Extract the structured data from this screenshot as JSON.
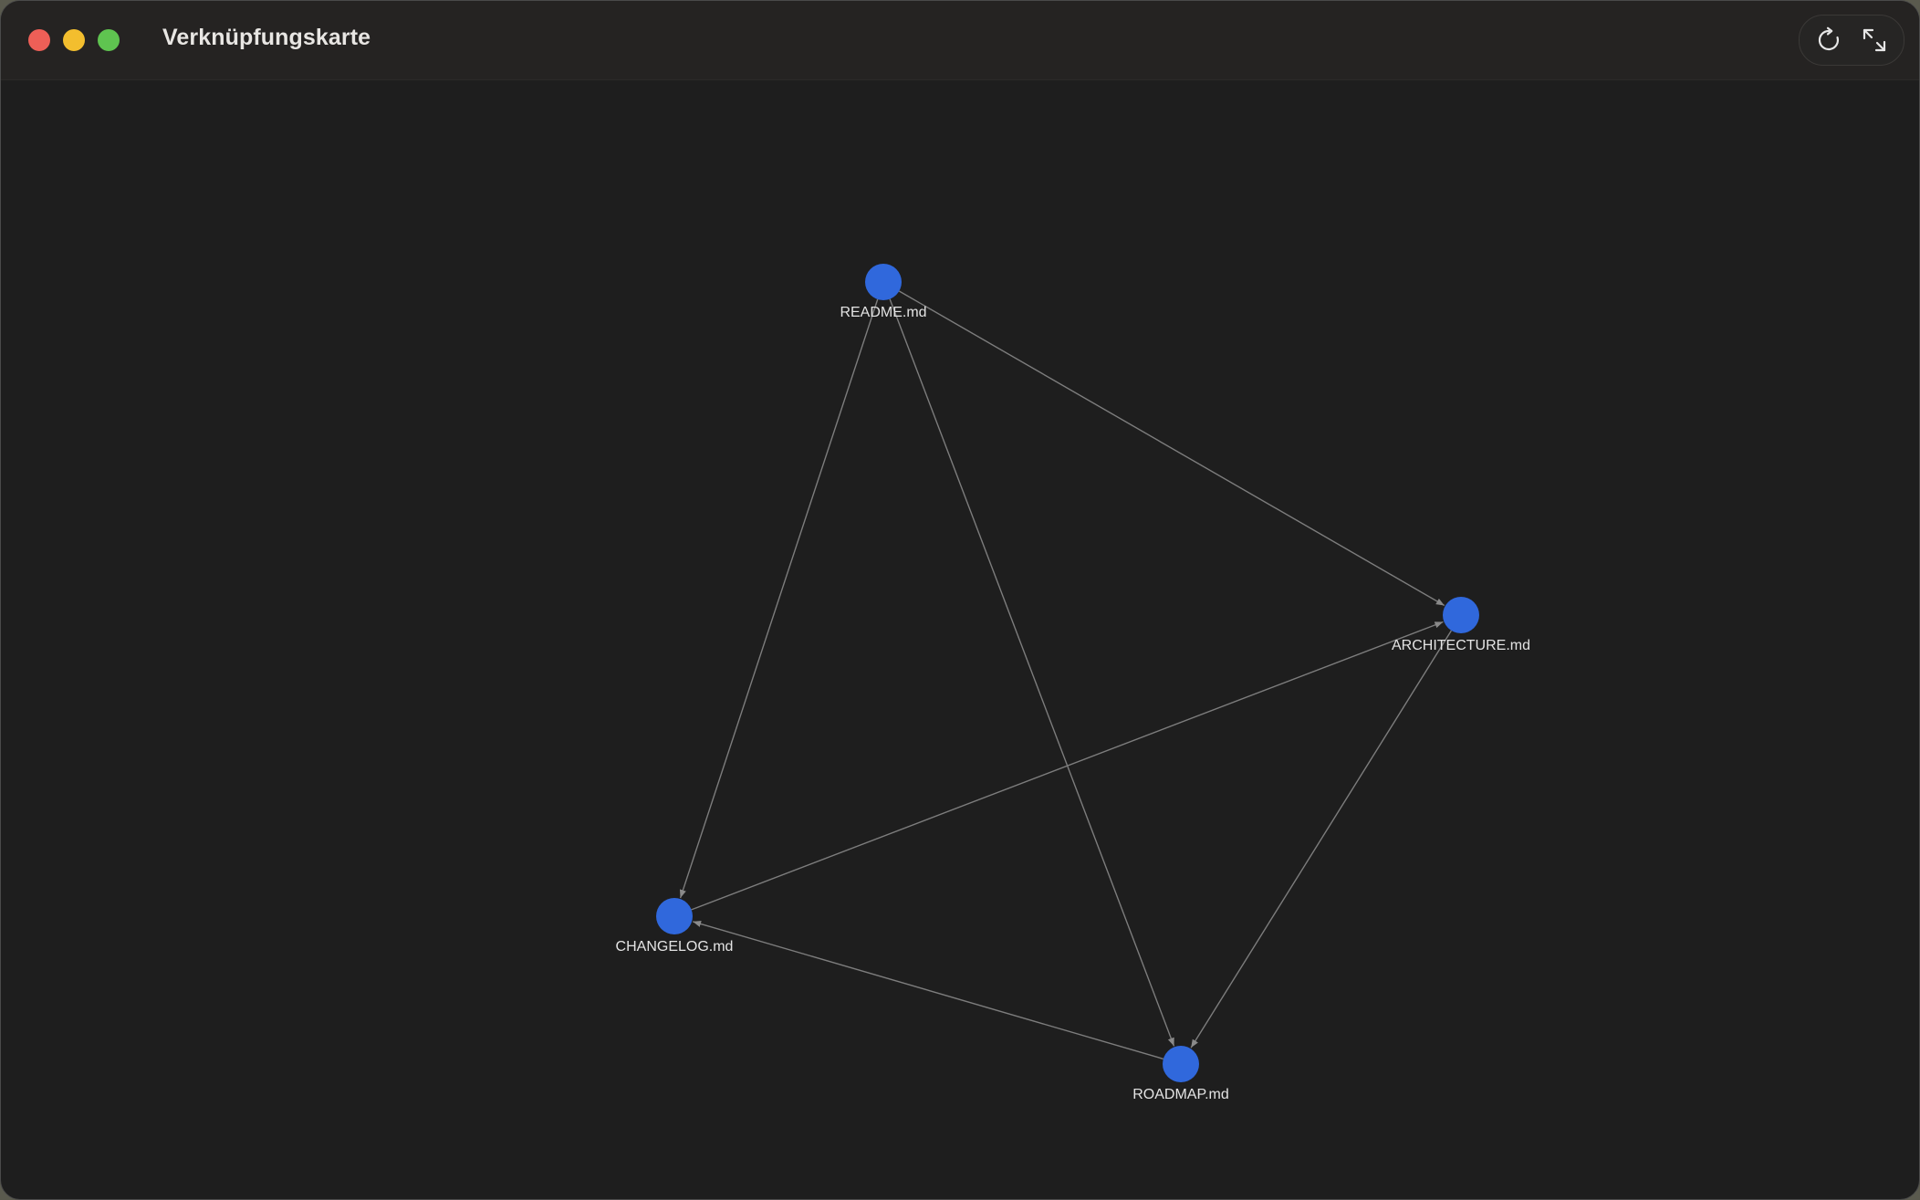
{
  "window": {
    "title": "Verknüpfungskarte"
  },
  "toolbar": {
    "buttons": [
      {
        "icon": "refresh-icon"
      },
      {
        "icon": "expand-icon"
      }
    ]
  },
  "colors": {
    "node": "#3068dc",
    "edge": "#7d7d7d",
    "background": "#1e1e1e",
    "titlebar": "#252322"
  },
  "graph": {
    "nodes": [
      {
        "id": "readme",
        "label": "README.md"
      },
      {
        "id": "architecture",
        "label": "ARCHITECTURE.md"
      },
      {
        "id": "changelog",
        "label": "CHANGELOG.md"
      },
      {
        "id": "roadmap",
        "label": "ROADMAP.md"
      }
    ],
    "edges": [
      {
        "source": "readme",
        "target": "architecture"
      },
      {
        "source": "readme",
        "target": "changelog"
      },
      {
        "source": "readme",
        "target": "roadmap"
      },
      {
        "source": "changelog",
        "target": "architecture"
      },
      {
        "source": "architecture",
        "target": "roadmap"
      },
      {
        "source": "roadmap",
        "target": "changelog"
      }
    ]
  }
}
